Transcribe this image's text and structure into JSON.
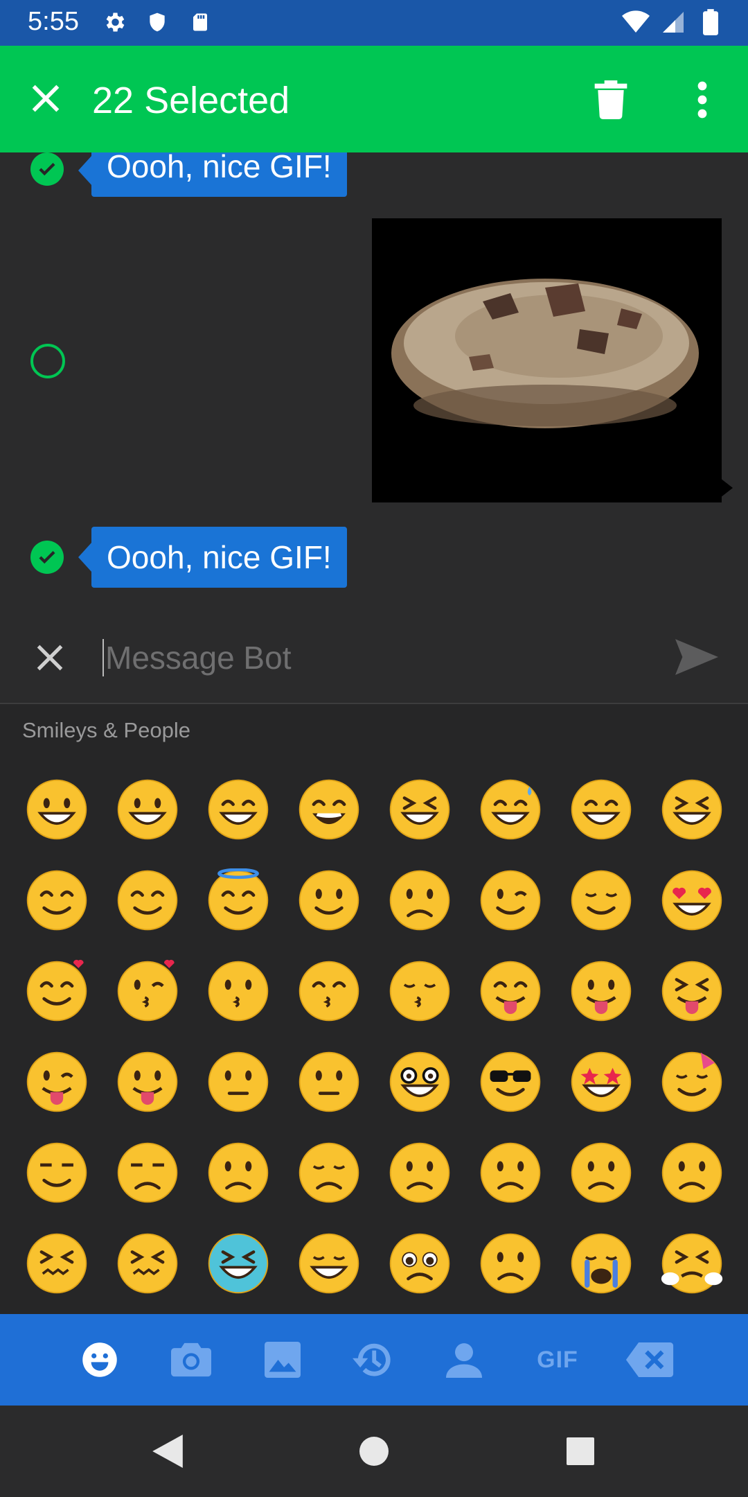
{
  "status_bar": {
    "time": "5:55",
    "left_icons": [
      "gear-icon",
      "shield-icon",
      "sd-card-icon"
    ],
    "right_icons": [
      "wifi-icon",
      "cell-signal-icon",
      "battery-icon"
    ]
  },
  "action_bar": {
    "title": "22 Selected",
    "color": "#00c653"
  },
  "messages": [
    {
      "type": "text",
      "text": "Oooh, nice GIF!",
      "selected": true
    },
    {
      "type": "gif",
      "description": "cookie",
      "selected": false
    },
    {
      "type": "text",
      "text": "Oooh, nice GIF!",
      "selected": true
    }
  ],
  "composer": {
    "placeholder": "Message Bot",
    "value": ""
  },
  "emoji_panel": {
    "category": "Smileys & People",
    "emojis": [
      "grinning-face",
      "grinning-face-big-eyes",
      "grinning-face-smiling-eyes",
      "beaming-face",
      "squinting-laughing",
      "grinning-sweat",
      "tears-of-joy",
      "rolling-on-floor-laughing",
      "smiling-face-smiling-eyes",
      "smiling-blush",
      "halo",
      "slightly-smiling",
      "upside-down",
      "winking",
      "relieved",
      "heart-eyes",
      "smiling-hearts",
      "kissing-heart",
      "kissing",
      "kissing-smiling-eyes",
      "kissing-closed-eyes",
      "yum",
      "tongue-out",
      "squinting-tongue",
      "winking-tongue",
      "zany",
      "raised-eyebrow",
      "monocle",
      "nerd",
      "sunglasses",
      "star-struck",
      "partying",
      "smirking",
      "unamused",
      "disappointed",
      "pensive",
      "worried",
      "confused",
      "slightly-frowning",
      "frowning",
      "persevering",
      "confounded",
      "tired-cold-sweat",
      "weary",
      "pleading",
      "sad-sweat",
      "loudly-crying",
      "steam-from-nose"
    ]
  },
  "keyboard_tabs": [
    "smiley-tab-icon",
    "camera-tab-icon",
    "image-tab-icon",
    "history-tab-icon",
    "contact-tab-icon",
    "GIF",
    "backspace-icon"
  ],
  "colors": {
    "status_bar": "#1a57a8",
    "accent_green": "#00c653",
    "bubble_blue": "#1a74d6",
    "keyboard_bar": "#1f6fd6",
    "background": "#2b2b2c"
  }
}
